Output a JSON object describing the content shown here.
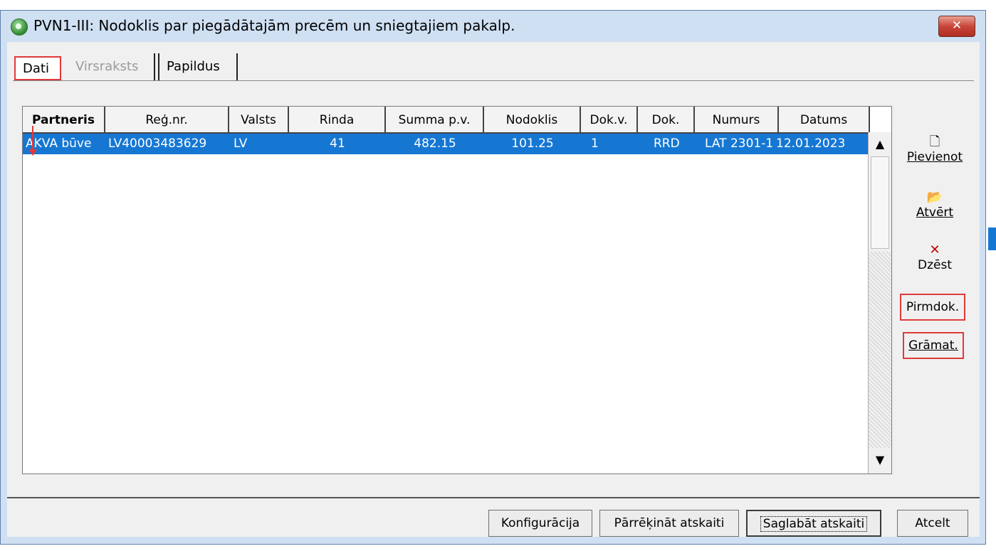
{
  "window": {
    "title": "PVN1-III: Nodoklis par piegādātajām precēm un sniegtajiem pakalp.",
    "close_label": "✕"
  },
  "tabs": [
    {
      "label": "Dati"
    },
    {
      "label": "Virsraksts"
    },
    {
      "label": "Papildus"
    }
  ],
  "grid": {
    "columns": [
      "Partneris",
      "Reģ.nr.",
      "Valsts",
      "Rinda",
      "Summa p.v.",
      "Nodoklis",
      "Dok.v.",
      "Dok.",
      "Numurs",
      "Datums"
    ],
    "rows": [
      [
        "AKVA būve",
        "LV40003483629",
        "LV",
        "41",
        "482.15",
        "101.25",
        "1",
        "RRD",
        "LAT 2301-1",
        "12.01.2023"
      ]
    ]
  },
  "side_actions": {
    "add": "Pievienot",
    "open": "Atvērt",
    "delete": "Dzēst",
    "source_doc": "Pirmdok.",
    "ledger": "Grāmat."
  },
  "footer": {
    "config": "Konfigurācija",
    "recalc": "Pārrēķināt atskaiti",
    "save": "Saglabāt atskaiti",
    "cancel": "Atcelt"
  },
  "colors": {
    "selection": "#1677d3",
    "highlight": "#e03a3a",
    "titlebar": "#cfe0f3"
  }
}
